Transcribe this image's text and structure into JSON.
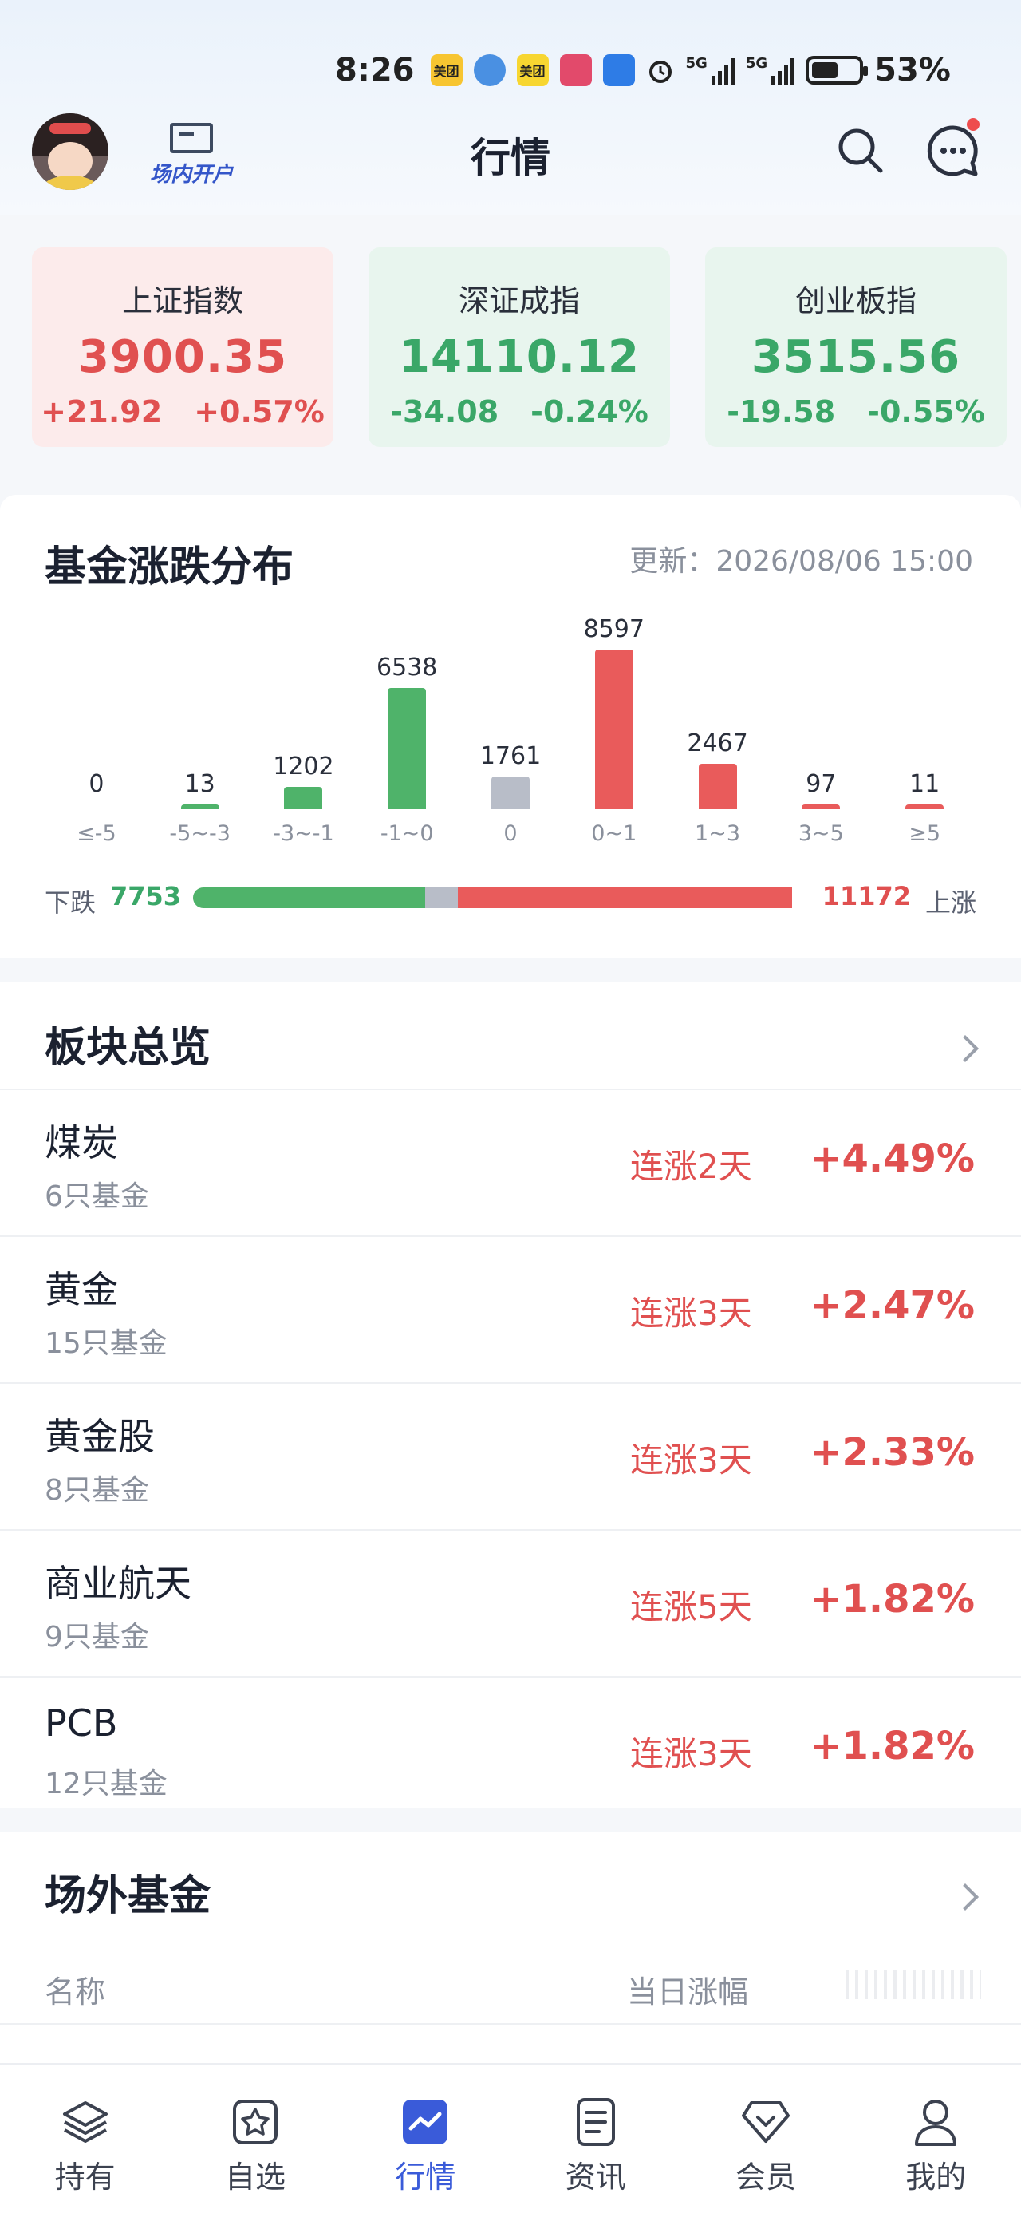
{
  "status_bar": {
    "time": "8:26",
    "apps": [
      "美团",
      "美团"
    ],
    "network_1": "5G",
    "network_2": "5G",
    "battery": "53%"
  },
  "header": {
    "open_account_label": "场内开户",
    "title": "行情"
  },
  "indices": [
    {
      "name": "上证指数",
      "value": "3900.35",
      "change": "+21.92",
      "percent": "+0.57%",
      "trend": "up"
    },
    {
      "name": "深证成指",
      "value": "14110.12",
      "change": "-34.08",
      "percent": "-0.24%",
      "trend": "down"
    },
    {
      "name": "创业板指",
      "value": "3515.56",
      "change": "-19.58",
      "percent": "-0.55%",
      "trend": "down"
    }
  ],
  "distribution": {
    "title": "基金涨跌分布",
    "updated": "更新：2026/08/06 15:00",
    "down_label": "下跌",
    "down_count": "7753",
    "up_label": "上涨",
    "up_count": "11172"
  },
  "chart_data": {
    "type": "bar",
    "categories": [
      "≤-5",
      "-5~-3",
      "-3~-1",
      "-1~0",
      "0",
      "0~1",
      "1~3",
      "3~5",
      "≥5"
    ],
    "values": [
      0,
      13,
      1202,
      6538,
      1761,
      8597,
      2467,
      97,
      11
    ],
    "colors": [
      "#4fb36a",
      "#4fb36a",
      "#4fb36a",
      "#4fb36a",
      "#b8bdc8",
      "#e95b5b",
      "#e95b5b",
      "#e95b5b",
      "#e95b5b"
    ],
    "summary": {
      "down": 7753,
      "flat": 1761,
      "up": 11172
    }
  },
  "sectors": {
    "title": "板块总览",
    "rows": [
      {
        "name": "煤炭",
        "count": "6只基金",
        "streak": "连涨2天",
        "change": "+4.49%"
      },
      {
        "name": "黄金",
        "count": "15只基金",
        "streak": "连涨3天",
        "change": "+2.47%"
      },
      {
        "name": "黄金股",
        "count": "8只基金",
        "streak": "连涨3天",
        "change": "+2.33%"
      },
      {
        "name": "商业航天",
        "count": "9只基金",
        "streak": "连涨5天",
        "change": "+1.82%"
      },
      {
        "name": "PCB",
        "count": "12只基金",
        "streak": "连涨3天",
        "change": "+1.82%"
      }
    ]
  },
  "otc_funds": {
    "title": "场外基金",
    "col_name": "名称",
    "col_change": "当日涨幅"
  },
  "tabbar": [
    {
      "label": "持有",
      "icon": "layers-icon",
      "active": false
    },
    {
      "label": "自选",
      "icon": "star-icon",
      "active": false
    },
    {
      "label": "行情",
      "icon": "chart-icon",
      "active": true
    },
    {
      "label": "资讯",
      "icon": "document-icon",
      "active": false
    },
    {
      "label": "会员",
      "icon": "diamond-icon",
      "active": false
    },
    {
      "label": "我的",
      "icon": "user-icon",
      "active": false
    }
  ],
  "colors": {
    "up": "#e05050",
    "down": "#3aa768",
    "accent": "#3a5bd9"
  }
}
